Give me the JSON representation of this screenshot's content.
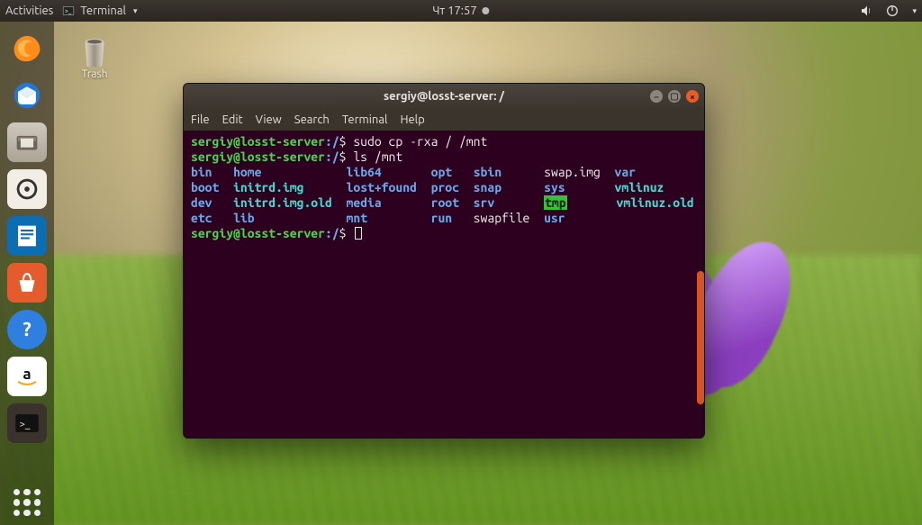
{
  "topbar": {
    "activities": "Activities",
    "app_label": "Terminal",
    "clock": "Чт 17:57"
  },
  "desktop": {
    "trash_label": "Trash"
  },
  "dock": {
    "firefox": "firefox-icon",
    "thunderbird": "thunderbird-icon",
    "files": "files-icon",
    "rhythmbox": "rhythmbox-icon",
    "writer": "writer-icon",
    "software": "software-icon",
    "help": "help-icon",
    "amazon": "amazon-icon",
    "terminal": "terminal-icon",
    "apps": "apps-grid-icon"
  },
  "window": {
    "title": "sergiy@losst-server: /",
    "menu": [
      "File",
      "Edit",
      "View",
      "Search",
      "Terminal",
      "Help"
    ]
  },
  "term": {
    "prompt_user": "sergiy@losst-server",
    "prompt_path": "/",
    "prompt_sym": "$",
    "prompt_colon": ":",
    "cmd1": "sudo cp -rxa / /mnt",
    "cmd2": "ls /mnt",
    "ls": {
      "r1": {
        "bin": "bin",
        "home": "home",
        "lib64": "lib64",
        "opt": "opt",
        "sbin": "sbin",
        "swap": "swap.img",
        "var": "var"
      },
      "r2": {
        "boot": "boot",
        "initrd": "initrd.img",
        "lostfound": "lost+found",
        "proc": "proc",
        "snap": "snap",
        "sys": "sys",
        "vmlinuz": "vmlinuz"
      },
      "r3": {
        "dev": "dev",
        "initrdold": "initrd.img.old",
        "media": "media",
        "root": "root",
        "srv": "srv",
        "tmp": "tmp",
        "vmlinuzold": "vmlinuz.old"
      },
      "r4": {
        "etc": "etc",
        "lib": "lib",
        "mnt": "mnt",
        "run": "run",
        "swapfile": "swapfile",
        "usr": "usr"
      }
    }
  }
}
